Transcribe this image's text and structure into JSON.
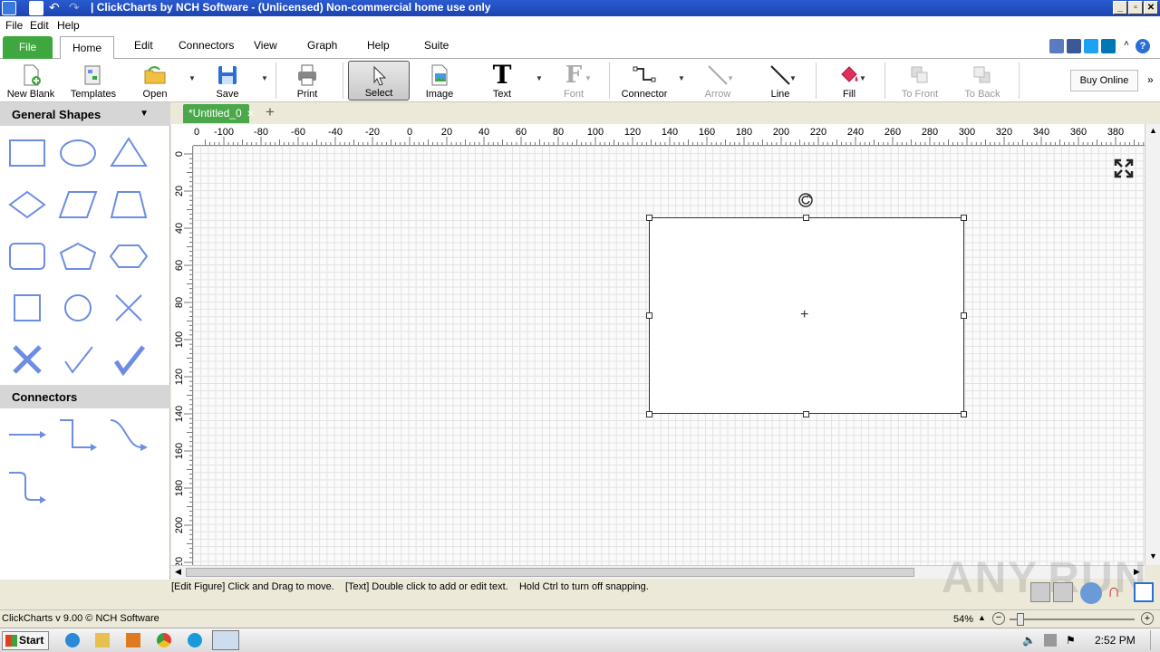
{
  "app": {
    "title": "| ClickCharts by NCH Software - (Unlicensed) Non-commercial home use only",
    "menu": [
      "File",
      "Edit",
      "Help"
    ],
    "win_buttons": [
      "_",
      "▫",
      "✕"
    ]
  },
  "ribbon": {
    "tabs": [
      "File",
      "Home",
      "Edit",
      "Connectors",
      "View",
      "Graph",
      "Help",
      "Suite"
    ],
    "tools": {
      "new_blank": "New Blank",
      "templates": "Templates",
      "open": "Open",
      "save": "Save",
      "print": "Print",
      "select": "Select",
      "image": "Image",
      "text": "Text",
      "font": "Font",
      "connector": "Connector",
      "arrow": "Arrow",
      "line": "Line",
      "fill": "Fill",
      "to_front": "To Front",
      "to_back": "To Back",
      "buy_online": "Buy Online"
    }
  },
  "panel": {
    "shapes_title": "General Shapes",
    "connectors_title": "Connectors",
    "shape_color": "#6b8de3"
  },
  "document": {
    "tab_label": "*Untitled_0",
    "close_glyph": "✕",
    "add_glyph": "+"
  },
  "rulers": {
    "h_ticks": [
      "-100",
      "-80",
      "-60",
      "-40",
      "-20",
      "0",
      "20",
      "40",
      "60",
      "80",
      "100",
      "120",
      "140",
      "160",
      "180",
      "200",
      "220",
      "240",
      "260",
      "280",
      "300",
      "320",
      "340",
      "360",
      "380"
    ],
    "h_zero": "0",
    "v_ticks": [
      "0",
      "20",
      "40",
      "60",
      "80",
      "100",
      "120",
      "140",
      "160",
      "180",
      "200",
      "20"
    ]
  },
  "hint": "[Edit Figure] Click and Drag to move.    [Text] Double click to add or edit text.    Hold Ctrl to turn off snapping.",
  "status": {
    "version": "ClickCharts v 9.00 © NCH Software",
    "zoom": "54%"
  },
  "taskbar": {
    "start": "Start",
    "clock": "2:52 PM"
  },
  "watermark": "ANY.RUN",
  "colors": {
    "titlebar": "#1c44b0",
    "file_tab": "#3ea83e",
    "doc_tab": "#4aa84a"
  }
}
